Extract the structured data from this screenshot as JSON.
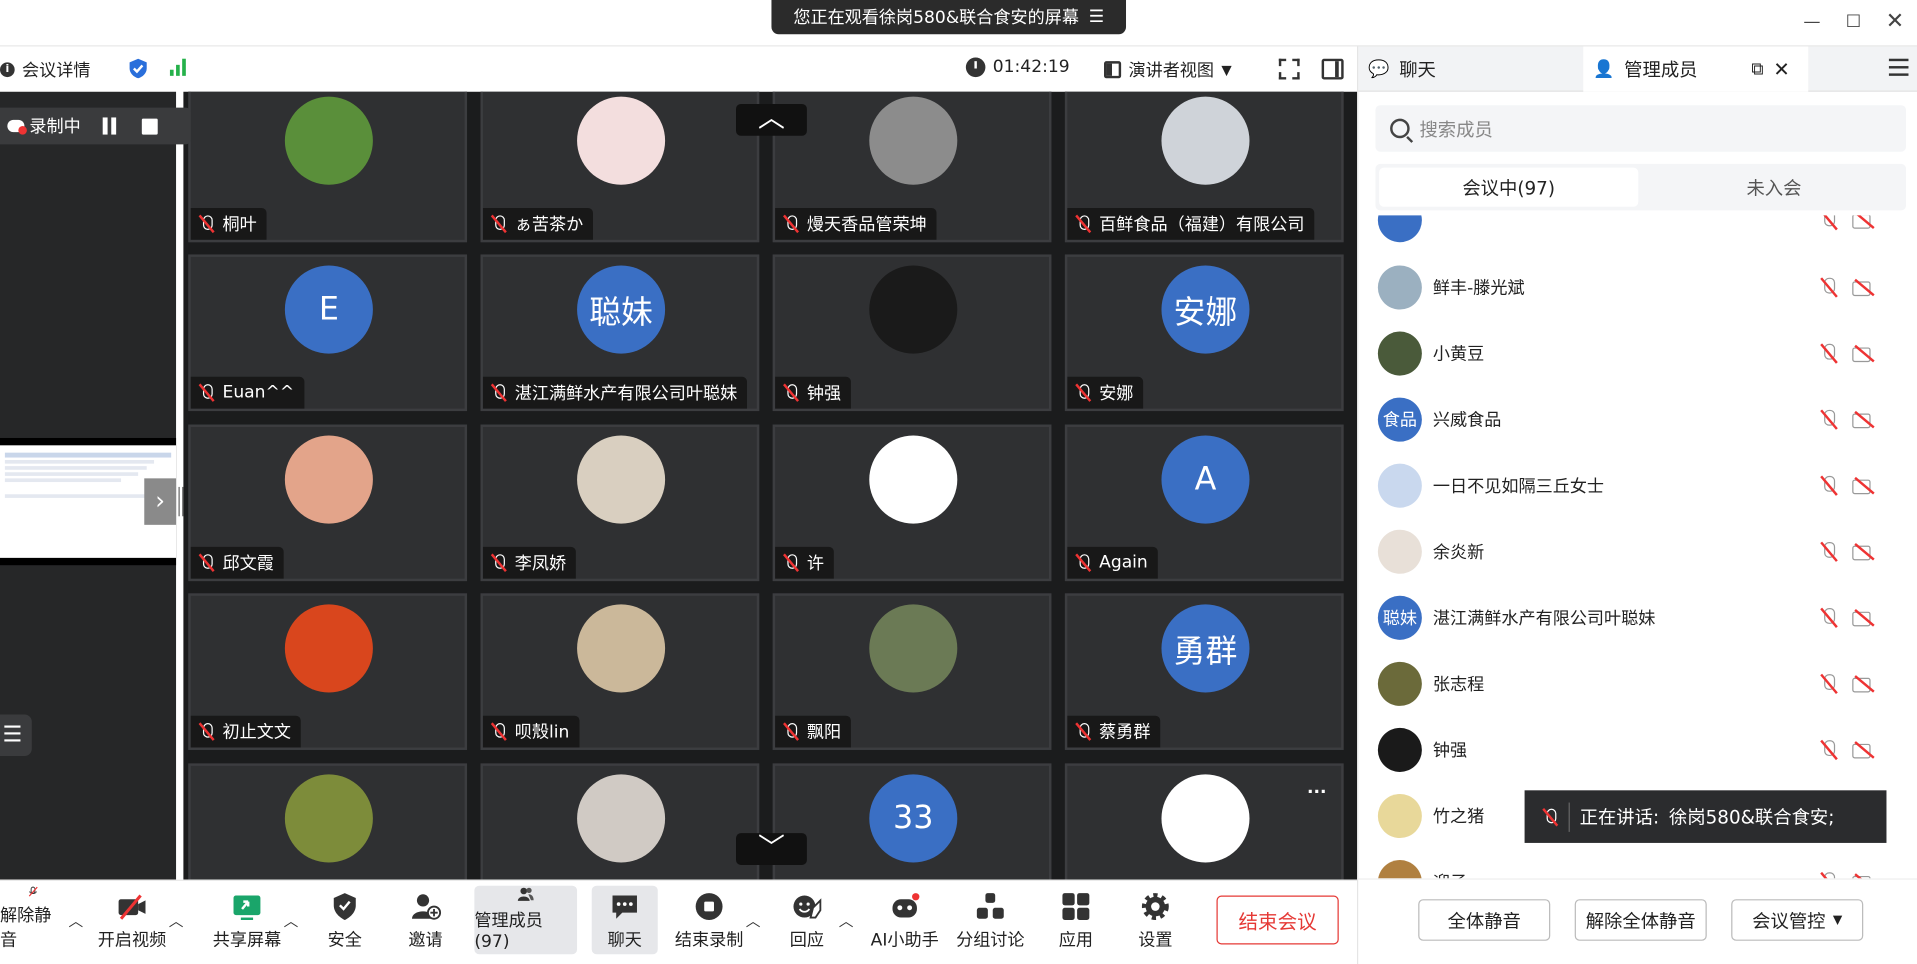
{
  "title_bar": {
    "share_banner": "您正在观看徐岗580&联合食安的屏幕",
    "banner_menu_icon": "menu-icon"
  },
  "top_bar": {
    "meeting_info": "会议详情",
    "timer": "01:42:19",
    "view_mode": "演讲者视图"
  },
  "recording": {
    "label": "录制中"
  },
  "grid": {
    "tiles": [
      {
        "name": "桐叶",
        "avatar_text": "",
        "avatar_color": "#5a8f3a"
      },
      {
        "name": "ぁ苦茶か",
        "avatar_text": "",
        "avatar_color": "#f3dede"
      },
      {
        "name": "熳天香品管荣坤",
        "avatar_text": "",
        "avatar_color": "#8c8c8c"
      },
      {
        "name": "百鲜食品（福建）有限公司",
        "avatar_text": "",
        "avatar_color": "#cfd3d9"
      },
      {
        "name": "Euan^^",
        "avatar_text": "E",
        "avatar_color": "#3a6fc4"
      },
      {
        "name": "湛江满鲜水产有限公司叶聪妹",
        "avatar_text": "聪妹",
        "avatar_color": "#3a6fc4"
      },
      {
        "name": "钟强",
        "avatar_text": "",
        "avatar_color": "#1a1a1a"
      },
      {
        "name": "安娜",
        "avatar_text": "安娜",
        "avatar_color": "#3a6fc4"
      },
      {
        "name": "邱文霞",
        "avatar_text": "",
        "avatar_color": "#e3a48a"
      },
      {
        "name": "李凤娇",
        "avatar_text": "",
        "avatar_color": "#d9cfc0"
      },
      {
        "name": "许",
        "avatar_text": "",
        "avatar_color": "#ffffff"
      },
      {
        "name": "Again",
        "avatar_text": "A",
        "avatar_color": "#3a6fc4"
      },
      {
        "name": "初止文文",
        "avatar_text": "",
        "avatar_color": "#d9461d"
      },
      {
        "name": "呗殼lin",
        "avatar_text": "",
        "avatar_color": "#cbb89a"
      },
      {
        "name": "飘阳",
        "avatar_text": "",
        "avatar_color": "#6b7a55"
      },
      {
        "name": "蔡勇群",
        "avatar_text": "勇群",
        "avatar_color": "#3a6fc4"
      },
      {
        "name": "",
        "avatar_text": "",
        "avatar_color": "#7d8c3a"
      },
      {
        "name": "",
        "avatar_text": "",
        "avatar_color": "#d0cac4"
      },
      {
        "name": "",
        "avatar_text": "33",
        "avatar_color": "#3a6fc4"
      },
      {
        "name": "",
        "avatar_text": "",
        "avatar_color": "#ffffff"
      }
    ]
  },
  "toolbar": {
    "unmute": "解除静音",
    "start_video": "开启视频",
    "share_screen": "共享屏幕",
    "security": "安全",
    "invite": "邀请",
    "manage_members": "管理成员(97)",
    "chat": "聊天",
    "end_recording": "结束录制",
    "reaction": "回应",
    "ai_assistant": "AI小助手",
    "breakout": "分组讨论",
    "apps": "应用",
    "settings": "设置",
    "end_meeting": "结束会议"
  },
  "right_panel": {
    "tab_chat": "聊天",
    "tab_members": "管理成员",
    "search_placeholder": "搜索成员",
    "in_meeting": "会议中(97)",
    "not_joined": "未入会",
    "members": [
      {
        "name": "鲜丰-滕光斌",
        "avatar_text": "",
        "avatar_color": "#9bb0c0"
      },
      {
        "name": "小黄豆",
        "avatar_text": "",
        "avatar_color": "#4a5a3a"
      },
      {
        "name": "兴威食品",
        "avatar_text": "食品",
        "avatar_color": "#3a6fc4"
      },
      {
        "name": "一日不见如隔三丘女士",
        "avatar_text": "",
        "avatar_color": "#c9d8ee"
      },
      {
        "name": "余炎新",
        "avatar_text": "",
        "avatar_color": "#e8e0d8"
      },
      {
        "name": "湛江满鲜水产有限公司叶聪妹",
        "avatar_text": "聪妹",
        "avatar_color": "#3a6fc4"
      },
      {
        "name": "张志程",
        "avatar_text": "",
        "avatar_color": "#6b6a3a"
      },
      {
        "name": "钟强",
        "avatar_text": "",
        "avatar_color": "#1a1a1a"
      },
      {
        "name": "竹之猪",
        "avatar_text": "",
        "avatar_color": "#e8d89a"
      },
      {
        "name": "迎子",
        "avatar_text": "",
        "avatar_color": "#b08040"
      }
    ],
    "speaking_label": "正在讲话:",
    "speaking_name": "徐岗580&联合食安;",
    "mute_all": "全体静音",
    "unmute_all": "解除全体静音",
    "meeting_control": "会议管控"
  }
}
